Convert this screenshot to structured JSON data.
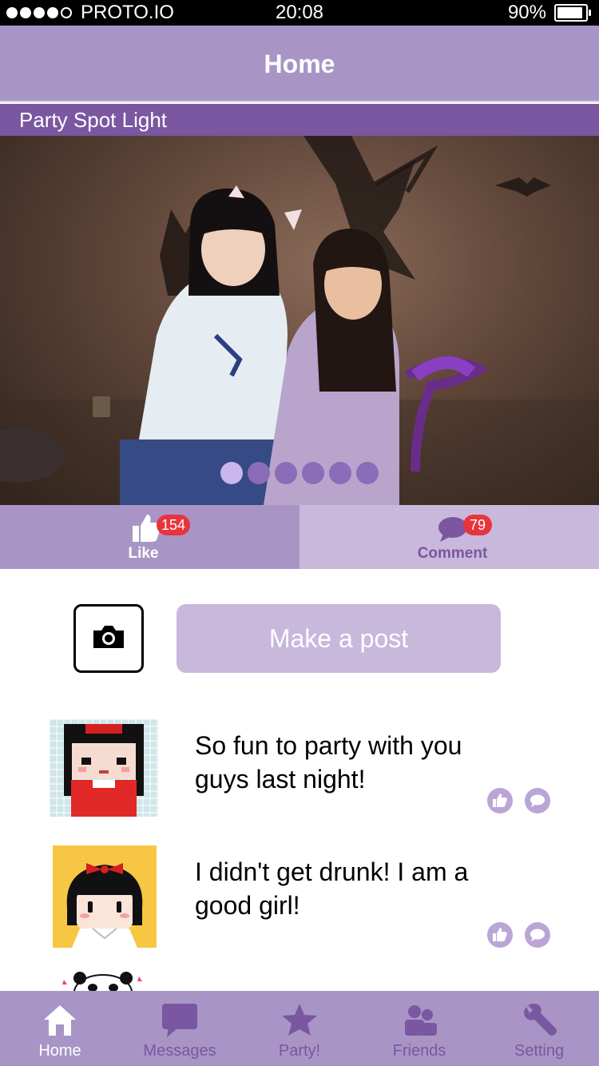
{
  "status_bar": {
    "carrier": "PROTO.IO",
    "time": "20:08",
    "battery": "90%",
    "battery_level": 0.9,
    "signal_bars_filled": 4,
    "signal_bars_total": 5
  },
  "header": {
    "title": "Home"
  },
  "spotlight": {
    "title": "Party Spot Light",
    "carousel_pages": 6,
    "carousel_active_index": 0
  },
  "actions": {
    "like_label": "Like",
    "like_count": "154",
    "comment_label": "Comment",
    "comment_count": "79"
  },
  "composer": {
    "post_button_label": "Make a post"
  },
  "feed": [
    {
      "text": "So fun to party with you guys last night!",
      "avatar": "pixel-girl-avatar"
    },
    {
      "text": "I didn't get drunk! I am a good girl!",
      "avatar": "cartoon-girl-avatar"
    }
  ],
  "tabs": [
    {
      "label": "Home",
      "icon": "home-icon",
      "active": true
    },
    {
      "label": "Messages",
      "icon": "message-icon",
      "active": false
    },
    {
      "label": "Party!",
      "icon": "star-icon",
      "active": false
    },
    {
      "label": "Friends",
      "icon": "friends-icon",
      "active": false
    },
    {
      "label": "Setting",
      "icon": "wrench-icon",
      "active": false
    }
  ],
  "colors": {
    "header": "#a895c6",
    "spotlight_bar": "#7a57a0",
    "comment_panel": "#c8b8dc",
    "badge": "#e8343c",
    "tab_inactive_text": "#7a57a0"
  }
}
